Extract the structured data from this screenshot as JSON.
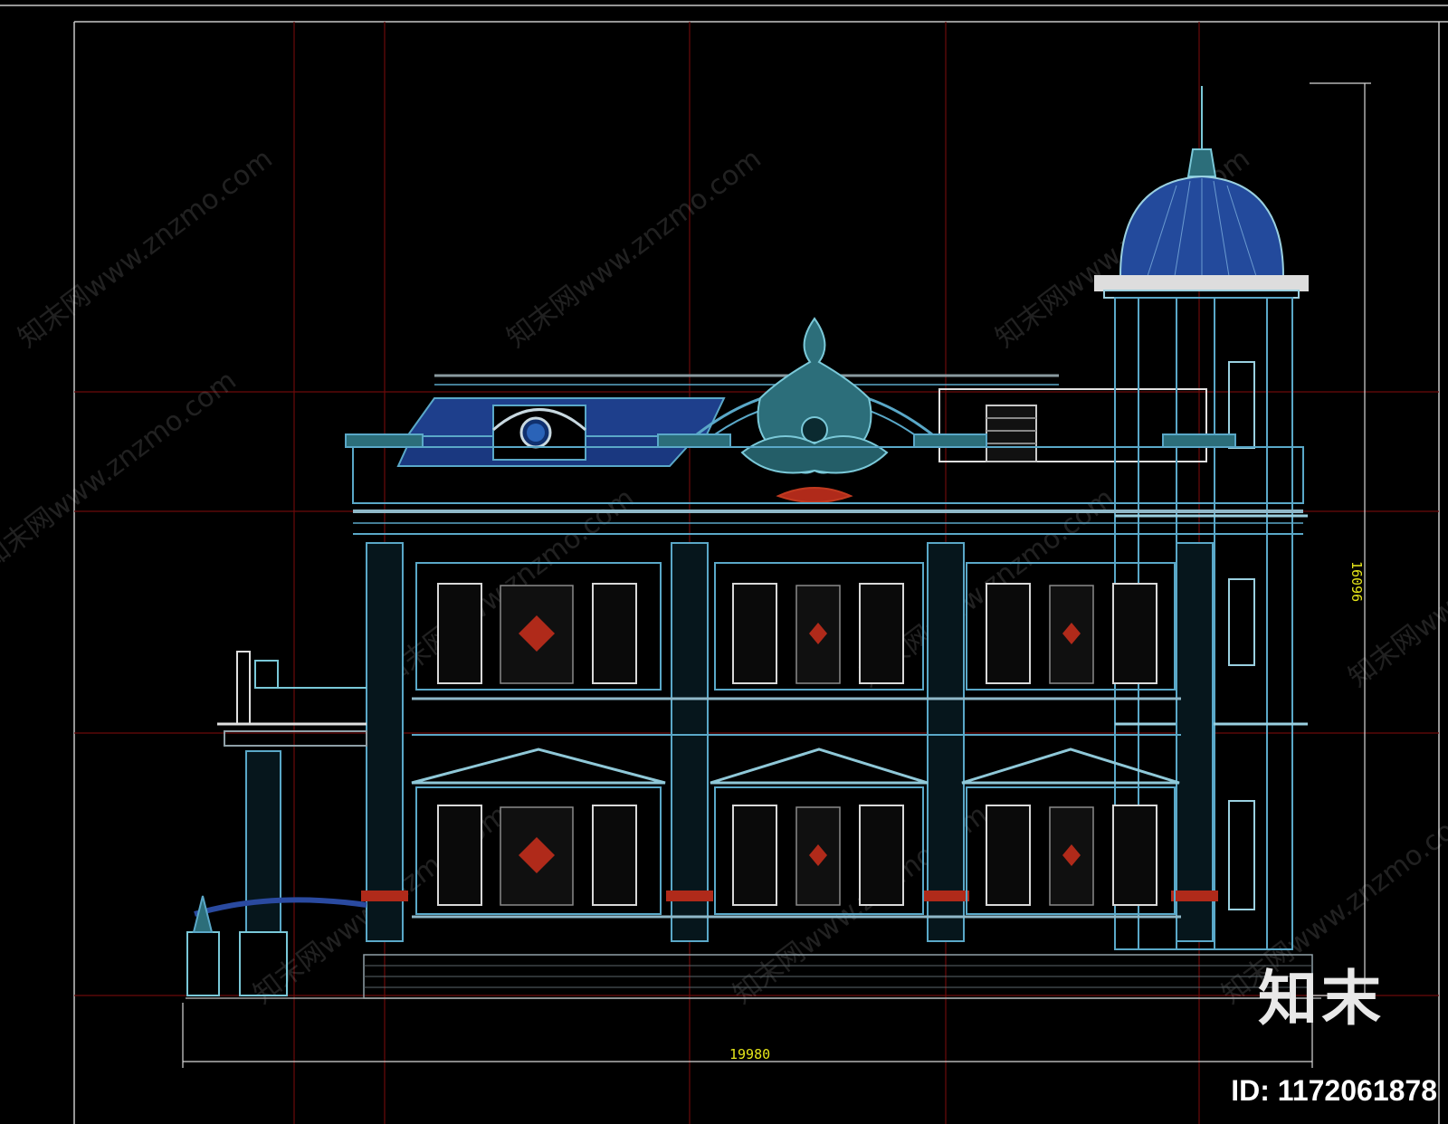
{
  "drawing": {
    "width_dimension": "19980",
    "height_dimension": "16096"
  },
  "watermark": {
    "text": "知末网www.znzmo.com"
  },
  "brand": {
    "logo_text": "知末",
    "id_text": "ID: 1172061878"
  },
  "colors": {
    "background": "#000000",
    "grid": "#6b0a0a",
    "linework": "#5aa8c8",
    "roof": "#1e3f8c",
    "dome": "#234a9c",
    "accent": "#b02a1a",
    "dimension": "#e6e61a"
  }
}
